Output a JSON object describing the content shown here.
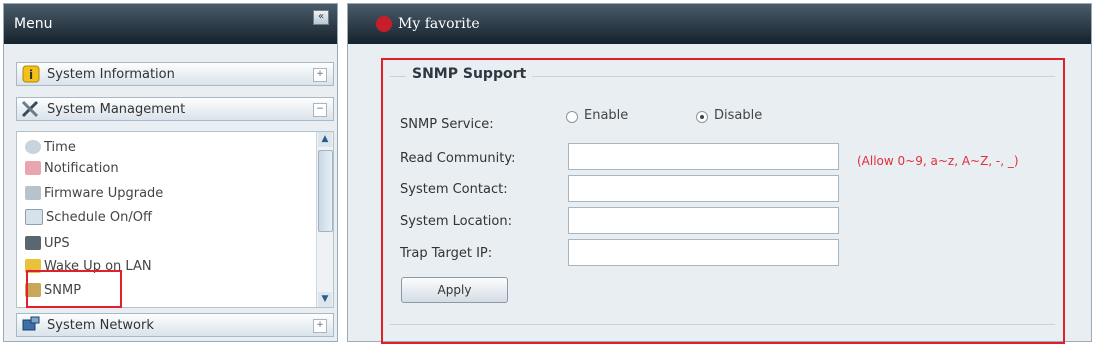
{
  "menu": {
    "title": "Menu",
    "collapse_icon": "«",
    "sections": [
      {
        "label": "System Information",
        "icon": "info-icon"
      },
      {
        "label": "System Management",
        "icon": "tools-icon"
      },
      {
        "label": "System Network",
        "icon": "network-icon"
      }
    ],
    "items": [
      {
        "label": "Time",
        "icon": "clock-icon"
      },
      {
        "label": "Notification",
        "icon": "notification-icon"
      },
      {
        "label": "Firmware Upgrade",
        "icon": "firmware-icon"
      },
      {
        "label": "Schedule On/Off",
        "icon": "schedule-icon"
      },
      {
        "label": "UPS",
        "icon": "ups-icon"
      },
      {
        "label": "Wake Up on LAN",
        "icon": "wake-icon"
      },
      {
        "label": "SNMP",
        "icon": "snmp-icon"
      }
    ]
  },
  "header": {
    "title": "My favorite"
  },
  "snmp": {
    "legend": "SNMP Support",
    "service_label": "SNMP Service:",
    "enable_label": "Enable",
    "disable_label": "Disable",
    "service_selected": "Disable",
    "read_community_label": "Read Community:",
    "system_contact_label": "System Contact:",
    "system_location_label": "System Location:",
    "trap_target_label": "Trap Target IP:",
    "hint": "(Allow 0~9, a~z, A~Z, -, _)",
    "apply_label": "Apply"
  },
  "colors": {
    "highlight": "#e0202a",
    "header_bg": "#15222c",
    "panel_bg": "#e8eef2"
  }
}
